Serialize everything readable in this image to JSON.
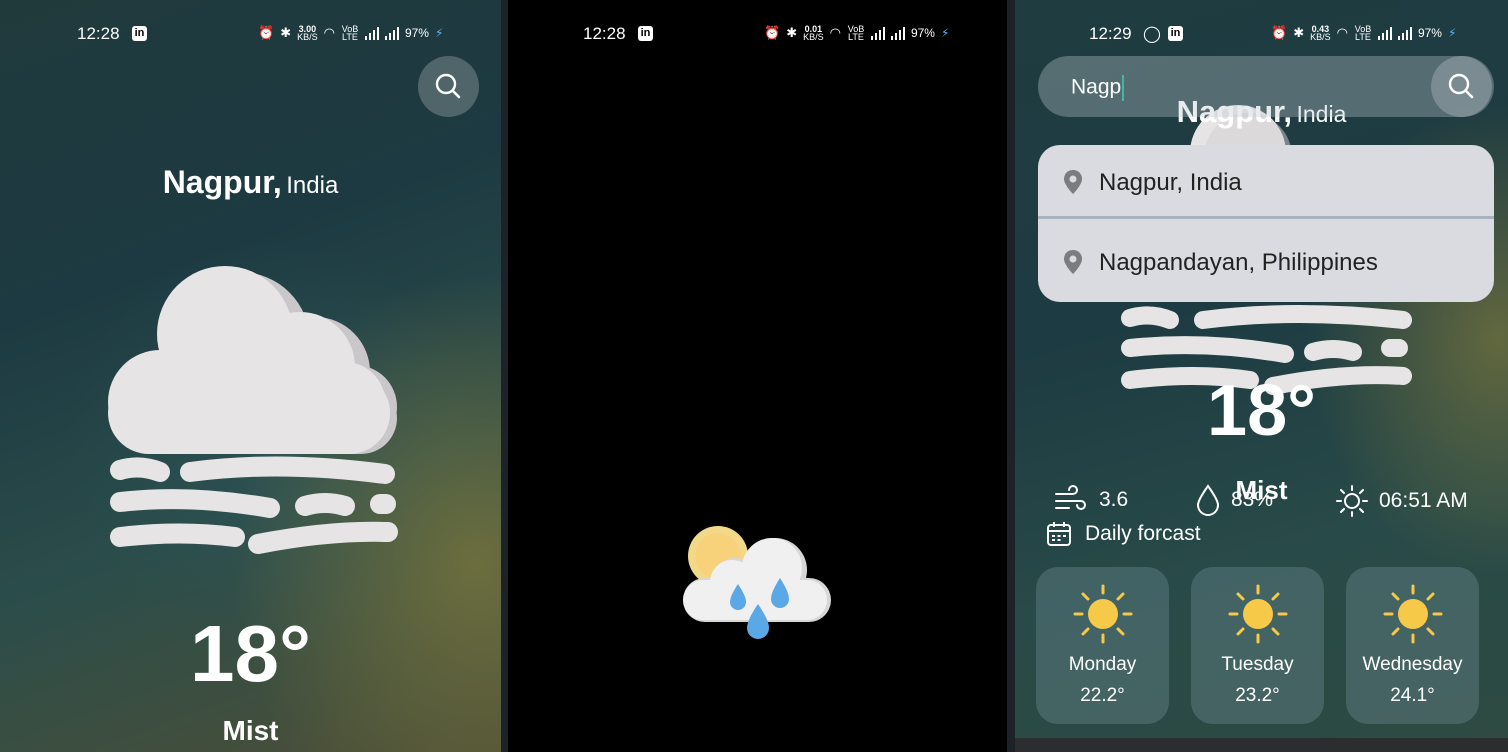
{
  "screen1": {
    "status": {
      "time": "12:28",
      "netspeed_value": "3.00",
      "netspeed_unit": "KB/S",
      "net_label": "VoB LTE",
      "battery": "97%"
    },
    "city_name": "Nagpur,",
    "country": "India",
    "weather_icon": "cloud-fog-icon",
    "temperature": "18°",
    "condition": "Mist"
  },
  "screen2": {
    "status": {
      "time": "12:28",
      "netspeed_value": "0.01",
      "netspeed_unit": "KB/S",
      "net_label": "VoB LTE",
      "battery": "97%"
    },
    "splash_icon": "sun-rain-cloud-icon"
  },
  "screen3": {
    "status": {
      "time": "12:29",
      "netspeed_value": "0.43",
      "netspeed_unit": "KB/S",
      "net_label": "VoB LTE",
      "battery": "97%"
    },
    "search": {
      "value": "Nagp"
    },
    "city_name": "Nagpur,",
    "country": "India",
    "suggestions": [
      {
        "label": "Nagpur, India"
      },
      {
        "label": "Nagpandayan, Philippines"
      }
    ],
    "temperature": "18°",
    "condition": "Mist",
    "stats": {
      "wind": "3.6",
      "humidity": "83%",
      "sunrise": "06:51 AM"
    },
    "forecast_title": "Daily forcast",
    "forecast": [
      {
        "day": "Monday",
        "temp": "22.2°"
      },
      {
        "day": "Tuesday",
        "temp": "23.2°"
      },
      {
        "day": "Wednesday",
        "temp": "24.1°"
      }
    ]
  },
  "colors": {
    "accent_caret": "#3fb6a8",
    "sun": "#f7c948",
    "rain_drop": "#5aa8e6",
    "cloud": "#e6e4e5"
  }
}
